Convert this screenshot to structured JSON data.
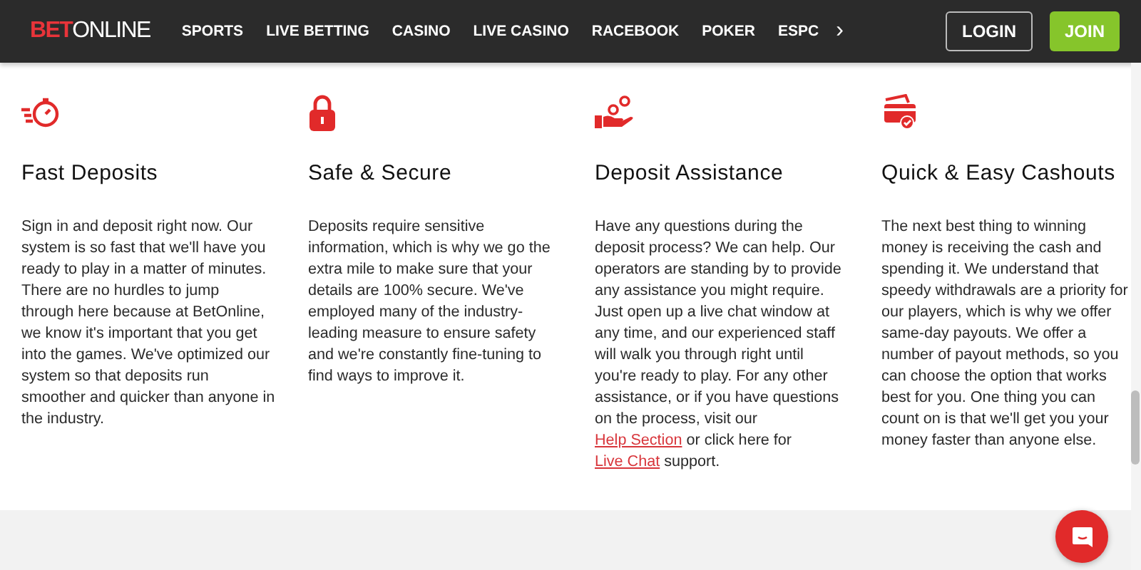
{
  "header": {
    "logo": {
      "part_1": "BET",
      "part_2": "ONLINE"
    },
    "nav": [
      {
        "label": "SPORTS"
      },
      {
        "label": "LIVE BETTING"
      },
      {
        "label": "CASINO"
      },
      {
        "label": "LIVE CASINO"
      },
      {
        "label": "RACEBOOK"
      },
      {
        "label": "POKER"
      },
      {
        "label": "ESPC"
      }
    ],
    "nav_more": "›",
    "buttons": [
      {
        "label": "LOGIN",
        "kind": "outline"
      },
      {
        "label": "JOIN",
        "kind": "primary"
      }
    ]
  },
  "features": [
    {
      "title": "Fast Deposits",
      "body": [
        {
          "text": "Sign in and deposit right now. Our system is so fast that we'll have you ready to play in a matter of minutes. There are no hurdles to jump through here because at BetOnline, we know it's important that you get into the games. We've optimized our system so that deposits run smoother and quicker than anyone in the industry."
        }
      ]
    },
    {
      "title": "Safe & Secure",
      "body": [
        {
          "text": "Deposits require sensitive information, which is why we go the extra mile to make sure that your details are 100% secure. We've employed many of the industry-leading measure to ensure safety and we're constantly fine-tuning to find ways to improve it."
        }
      ]
    },
    {
      "title": "Deposit Assistance",
      "body": [
        {
          "text": "Have any questions during the deposit process? We can help. Our operators are standing by to provide any assistance you might require. Just open up a live chat window at any time, and our experienced staff will walk you through right until you're ready to play. For any other assistance, or if you have questions on the process, visit our "
        },
        {
          "text": "Help Section",
          "kind": "link"
        },
        {
          "text": " or click here for "
        },
        {
          "text": "Live Chat",
          "kind": "link"
        },
        {
          "text": " support."
        }
      ]
    },
    {
      "title": "Quick & Easy Cashouts",
      "body": [
        {
          "text": "The next best thing to winning money is receiving the cash and spending it. We understand that speedy withdrawals are a priority for our players, which is why we offer same-day payouts. We offer a number of payout methods, so you can choose the option that works best for you. One thing you can count on is that we'll get you your money faster than anyone else."
        }
      ]
    }
  ]
}
